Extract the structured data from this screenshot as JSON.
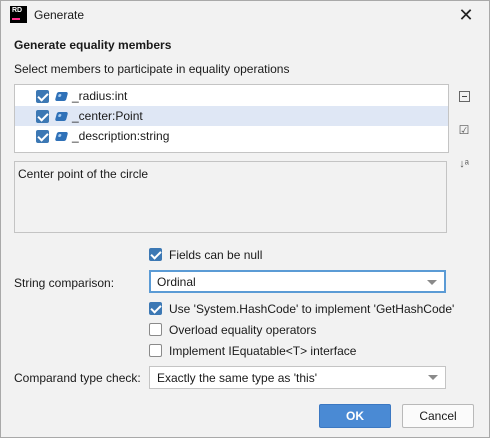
{
  "window": {
    "app_badge": "RD",
    "title": "Generate",
    "close_glyph": "✕",
    "icons": {
      "app": "rider-logo-icon",
      "close": "close-icon"
    }
  },
  "dialog": {
    "heading": "Generate equality members",
    "subheading": "Select members to participate in equality operations"
  },
  "members": [
    {
      "label": "_radius:int",
      "checked": true,
      "selected": false,
      "icon": "field-icon"
    },
    {
      "label": "_center:Point",
      "checked": true,
      "selected": true,
      "icon": "field-icon"
    },
    {
      "label": "_description:string",
      "checked": true,
      "selected": false,
      "icon": "field-icon"
    }
  ],
  "side_toolbar": {
    "collapse_icon": "collapse-all-icon",
    "check_glyph": "☑",
    "check_icon": "select-all-icon",
    "sort_glyph": "↓ᵃ",
    "sort_icon": "sort-alphabetically-icon"
  },
  "description": "Center point of the circle",
  "options": {
    "fields_null": {
      "label": "Fields can be null",
      "checked": true
    },
    "string_comparison": {
      "label": "String comparison:",
      "value": "Ordinal"
    },
    "hashcode": {
      "label": "Use 'System.HashCode' to implement 'GetHashCode'",
      "checked": true
    },
    "overload_ops": {
      "label": "Overload equality operators",
      "checked": false
    },
    "iequatable": {
      "label": "Implement IEquatable<T> interface",
      "checked": false
    },
    "comparand": {
      "label": "Comparand type check:",
      "value": "Exactly the same type as 'this'"
    }
  },
  "buttons": {
    "ok": "OK",
    "cancel": "Cancel"
  },
  "colors": {
    "accent": "#4a8ad4",
    "checkbox": "#3c78b4",
    "selection": "#dfe7f5",
    "field_icon": "#2f71b8"
  }
}
